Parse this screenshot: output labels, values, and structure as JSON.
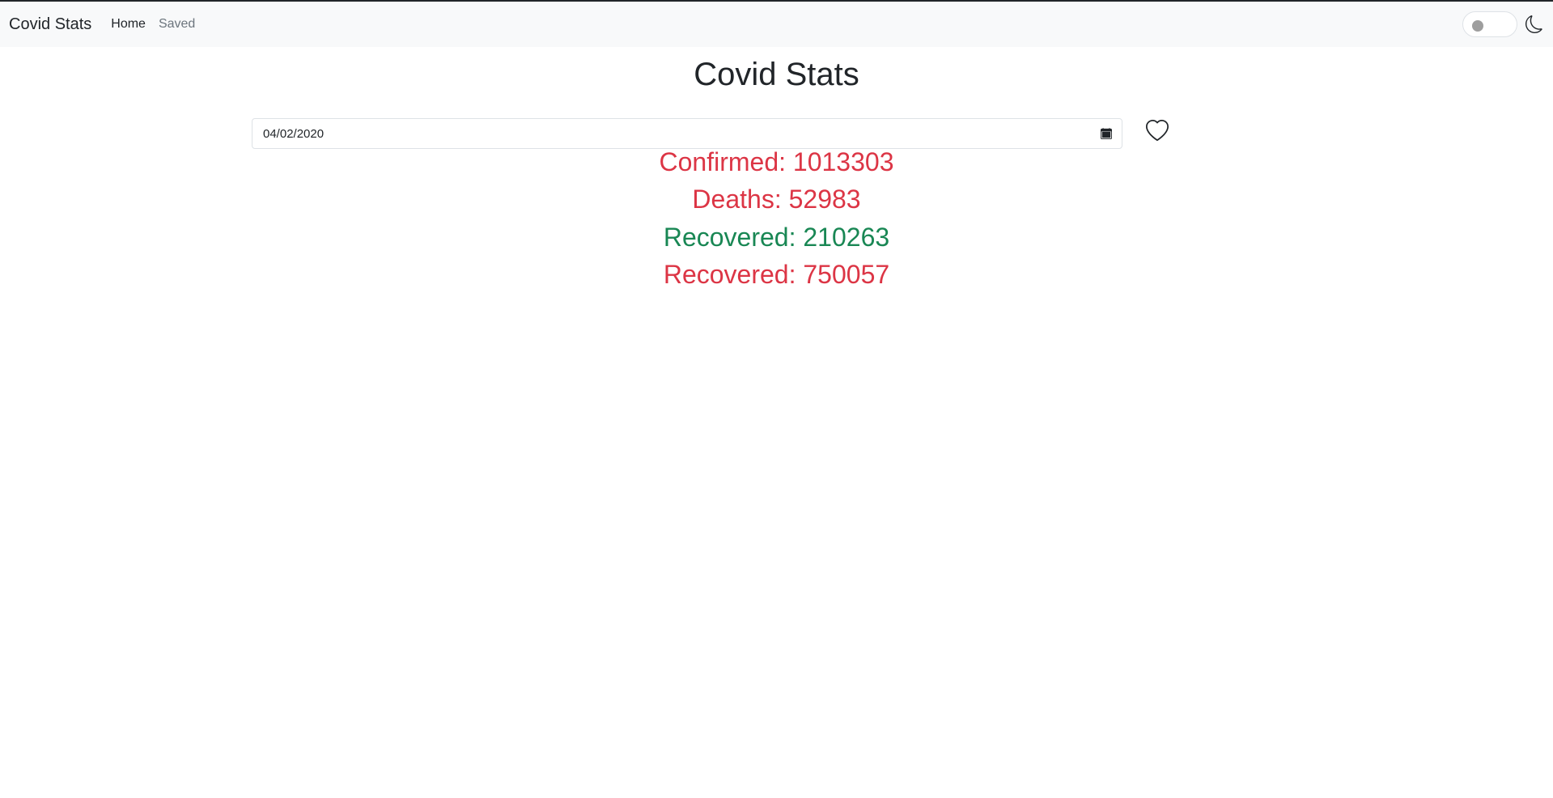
{
  "navbar": {
    "brand": "Covid Stats",
    "links": [
      {
        "label": "Home"
      },
      {
        "label": "Saved"
      }
    ]
  },
  "page": {
    "title": "Covid Stats"
  },
  "date_input": {
    "value": "04/02/2020"
  },
  "stats": [
    {
      "text": "Confirmed: 1013303",
      "color": "#dc3545"
    },
    {
      "text": "Deaths: 52983",
      "color": "#dc3545"
    },
    {
      "text": "Recovered: 210263",
      "color": "#198754"
    },
    {
      "text": "Recovered: 750057",
      "color": "#dc3545"
    }
  ],
  "icons": {
    "save": "heart-icon",
    "theme": "moon-icon",
    "calendar": "calendar-icon"
  }
}
